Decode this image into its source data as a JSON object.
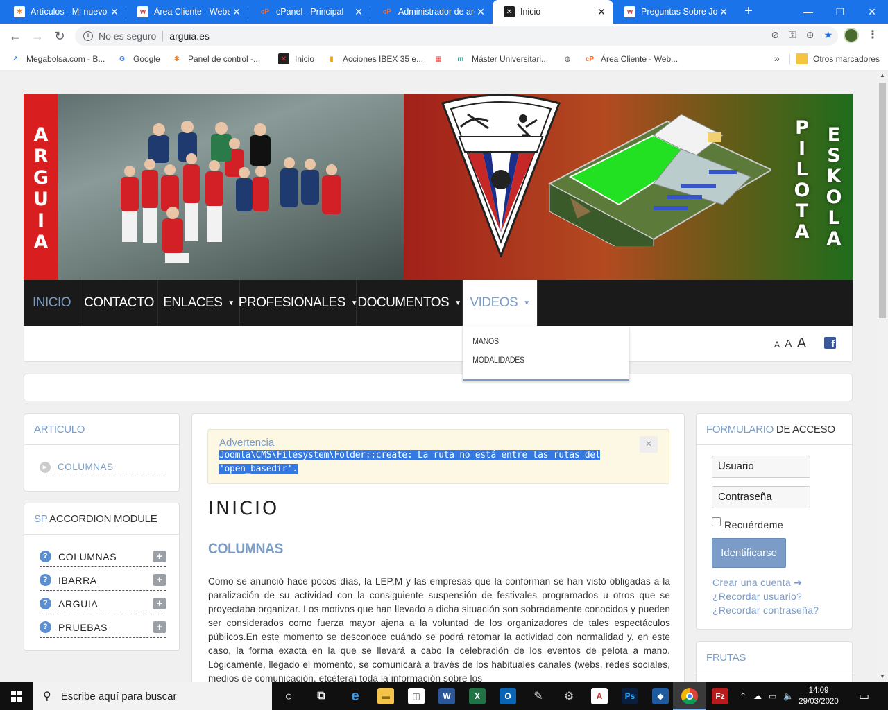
{
  "browser": {
    "tabs": [
      {
        "label": "Artículos - Mi nuevo",
        "icon": "joomla-icon",
        "color": "#f48024",
        "glyph": "✱"
      },
      {
        "label": "Área Cliente - Weber",
        "icon": "webempresa-icon",
        "color": "#d32f2f",
        "glyph": "w"
      },
      {
        "label": "cPanel - Principal",
        "icon": "cpanel-icon",
        "color": "#ff6c2c",
        "glyph": "cP"
      },
      {
        "label": "Administrador de arc",
        "icon": "cpanel-icon",
        "color": "#ff6c2c",
        "glyph": "cP"
      },
      {
        "label": "Inicio",
        "icon": "arguia-favicon-icon",
        "color": "#222",
        "glyph": "✕"
      },
      {
        "label": "Preguntas Sobre Joo",
        "icon": "webempresa-icon",
        "color": "#d32f2f",
        "glyph": "w"
      }
    ],
    "active_tab_index": 4,
    "address": {
      "security": "No es seguro",
      "url": "arguia.es"
    },
    "bookmarks": [
      {
        "label": "Megabolsa.com - B...",
        "icon": "chart-icon",
        "color": "#3a7bd5",
        "glyph": "↗"
      },
      {
        "label": "Google",
        "icon": "google-icon",
        "color": "#fff",
        "glyph": "G"
      },
      {
        "label": "Panel de control -...",
        "icon": "joomla-icon",
        "color": "#f48024",
        "glyph": "✱"
      },
      {
        "label": "Inicio",
        "icon": "arguia-favicon-icon",
        "color": "#222",
        "glyph": "✕"
      },
      {
        "label": "Acciones IBEX 35 e...",
        "icon": "bars-chart-icon",
        "color": "#e6a100",
        "glyph": "▮"
      },
      {
        "label": "",
        "icon": "calendar-icon",
        "color": "#e53935",
        "glyph": "▦"
      },
      {
        "label": "Máster Universitari...",
        "icon": "uni-icon",
        "color": "#00897b",
        "glyph": "m"
      },
      {
        "label": "",
        "icon": "globe-icon",
        "color": "#444",
        "glyph": "◍"
      },
      {
        "label": "Área Cliente - Web...",
        "icon": "cpanel-icon",
        "color": "#ff6c2c",
        "glyph": "cP"
      }
    ],
    "other_bookmarks": "Otros marcadores"
  },
  "site": {
    "banner_left_word": "ARGUIA",
    "banner_right_words": [
      "PILOTA",
      "ESKOLA"
    ],
    "nav": [
      {
        "label": "INICIO",
        "has_caret": false,
        "state": "active"
      },
      {
        "label": "CONTACTO",
        "has_caret": false,
        "state": ""
      },
      {
        "label": "ENLACES",
        "has_caret": true,
        "state": ""
      },
      {
        "label": "PROFESIONALES",
        "has_caret": true,
        "state": ""
      },
      {
        "label": "DOCUMENTOS",
        "has_caret": true,
        "state": ""
      },
      {
        "label": "VIDEOS",
        "has_caret": true,
        "state": "open"
      }
    ],
    "videos_dropdown": [
      "MANOS",
      "MODALIDADES"
    ],
    "font_sizes": [
      "A",
      "A",
      "A"
    ],
    "facebook_glyph": "f",
    "articulo_panel": {
      "title": "ARTICULO",
      "items": [
        "COLUMNAS"
      ]
    },
    "accordion_panel": {
      "title_accent": "SP",
      "title_rest": " ACCORDION MODULE",
      "items": [
        "COLUMNAS",
        "IBARRA",
        "ARGUIA",
        "PRUEBAS"
      ]
    },
    "alert": {
      "title": "Advertencia",
      "message": "Joomla\\CMS\\Filesystem\\Folder::create: La ruta no está entre las rutas del 'open_basedir'.",
      "close": "×"
    },
    "page_title": "INICIO",
    "article_title": "COLUMNAS",
    "article_body": "Como se anunció hace pocos días, la LEP.M y las empresas que la conforman se han visto obligadas a la paralización de su actividad con la consiguiente suspensión de festivales programados u otros que se proyectaba organizar. Los motivos que han llevado a dicha situación son sobradamente conocidos y pueden ser considerados como fuerza mayor ajena a la voluntad de los organizadores de tales espectáculos públicos.En este momento se desconoce cuándo se podrá retomar la actividad con normalidad y, en este caso, la forma exacta en la que se llevará a cabo la celebración de los eventos de pelota a mano. Lógicamente, llegado el momento, se comunicará a través de los habituales canales (webs, redes sociales, medios de comunicación, etcétera) toda la información sobre los",
    "login": {
      "title_accent": "FORMULARIO",
      "title_rest": " DE ACCESO",
      "username_placeholder": "Usuario",
      "password_placeholder": "Contraseña",
      "remember": "Recuérdeme",
      "submit": "Identificarse",
      "links": [
        "Crear una cuenta ➔",
        "¿Recordar usuario?",
        "¿Recordar contraseña?"
      ]
    },
    "frutas_title": "FRUTAS"
  },
  "taskbar": {
    "search_placeholder": "Escribe aquí para buscar",
    "time": "14:09",
    "date": "29/03/2020"
  },
  "colors": {
    "chrome_blue": "#1a73e8",
    "site_accent": "#7a9cc6",
    "nav_bg": "#1a1a1a",
    "alert_bg": "#fcf8e3",
    "selection": "#3478e0"
  }
}
